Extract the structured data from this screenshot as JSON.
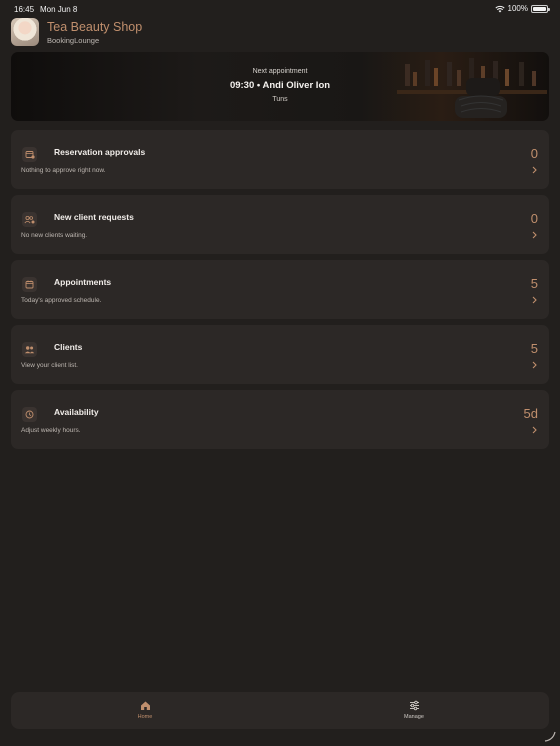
{
  "status": {
    "time": "16:45",
    "date": "Mon Jun 8",
    "battery": "100%",
    "battery_level": 1.0
  },
  "header": {
    "shop_name": "Tea Beauty Shop",
    "subtitle": "BookingLounge"
  },
  "banner": {
    "kicker": "Next appointment",
    "title": "09:30 • Andi Oliver Ion",
    "service": "Tuns"
  },
  "cards": [
    {
      "icon": "reservation-icon",
      "title": "Reservation approvals",
      "desc": "Nothing to approve right now.",
      "value": "0"
    },
    {
      "icon": "client-request-icon",
      "title": "New client requests",
      "desc": "No new clients waiting.",
      "value": "0"
    },
    {
      "icon": "calendar-icon",
      "title": "Appointments",
      "desc": "Today's approved schedule.",
      "value": "5"
    },
    {
      "icon": "clients-icon",
      "title": "Clients",
      "desc": "View your client list.",
      "value": "5"
    },
    {
      "icon": "clock-icon",
      "title": "Availability",
      "desc": "Adjust weekly hours.",
      "value": "5d"
    }
  ],
  "tabs": {
    "home": "Home",
    "manage": "Manage",
    "active": "home"
  },
  "colors": {
    "accent": "#c08f6d",
    "background": "#221f1d",
    "card": "#2c2826"
  }
}
